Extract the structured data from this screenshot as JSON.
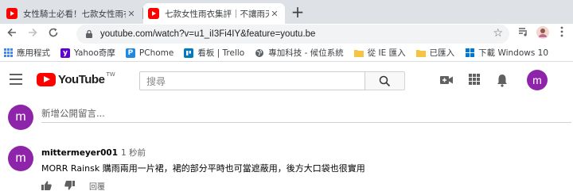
{
  "browser": {
    "tabs": [
      {
        "title": "女性騎士必看！七款女性雨衣實",
        "close": "✕",
        "favicon": "youtube",
        "active": false
      },
      {
        "title": "七款女性雨衣集評｜不讓雨天剝",
        "close": "✕",
        "favicon": "youtube",
        "active": true
      }
    ],
    "new_tab": "+",
    "url": "youtube.com/watch?v=u1_iI3Fi4IY&feature=youtu.be",
    "bookmarks": [
      {
        "label": "應用程式",
        "icon": "apps-grid-icon",
        "color": "#4285f4"
      },
      {
        "label": "Yahoo奇摩",
        "icon": "yahoo-icon",
        "color": "#5f01d1"
      },
      {
        "label": "PChome",
        "icon": "pchome-icon",
        "color": "#1e88e5"
      },
      {
        "label": "看板 | Trello",
        "icon": "trello-icon",
        "color": "#0079bf"
      },
      {
        "label": "專加科技 - 候位系統",
        "icon": "globe-icon",
        "color": "#5f6368"
      },
      {
        "label": "從 IE 匯入",
        "icon": "folder-icon",
        "color": "#f6c445"
      },
      {
        "label": "已匯入",
        "icon": "folder-icon",
        "color": "#f6c445"
      },
      {
        "label": "下載 Windows 10",
        "icon": "windows-icon",
        "color": "#0078d7"
      }
    ]
  },
  "youtube": {
    "logo_text": "YouTube",
    "region": "TW",
    "search_placeholder": "搜尋",
    "account_initial": "m",
    "accent_color": "#ff0000",
    "avatar_color": "#8e24aa"
  },
  "comments": {
    "add_placeholder": "新增公開留言...",
    "items": [
      {
        "author": "mittermeyer001",
        "time": "1 秒前",
        "text": "MORR Rainsk 購雨兩用一片裙，裙的部分平時也可當遮蔽用，後方大口袋也很實用",
        "reply_label": "回覆",
        "avatar_initial": "m"
      }
    ]
  }
}
